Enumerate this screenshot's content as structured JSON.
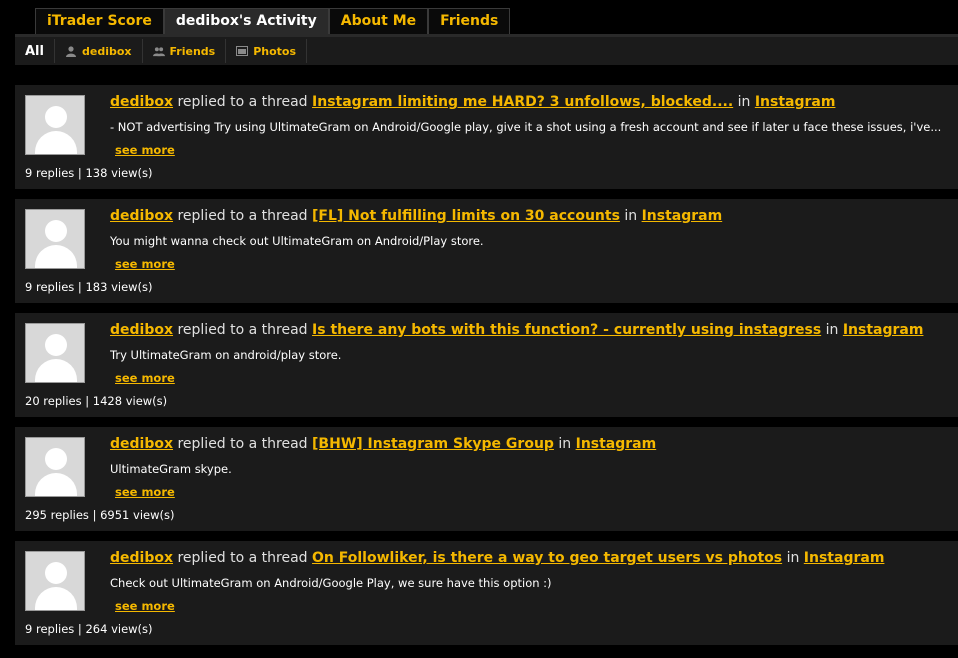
{
  "tabs": [
    {
      "label": "iTrader Score",
      "active": false
    },
    {
      "label": "dedibox's Activity",
      "active": true
    },
    {
      "label": "About Me",
      "active": false
    },
    {
      "label": "Friends",
      "active": false
    }
  ],
  "subtabs": [
    {
      "label": "All",
      "icon": "none",
      "active": true
    },
    {
      "label": "dedibox",
      "icon": "user-icon",
      "active": false
    },
    {
      "label": "Friends",
      "icon": "users-icon",
      "active": false
    },
    {
      "label": "Photos",
      "icon": "photo-icon",
      "active": false
    }
  ],
  "colors": {
    "accent": "#f5b800",
    "panel": "#1b1b1b",
    "background": "#000000"
  },
  "items": [
    {
      "user": "dedibox",
      "action": " replied to a thread ",
      "thread": "Instagram limiting me HARD? 3 unfollows, blocked....",
      "in": " in ",
      "forum": "Instagram",
      "snippet": "- NOT advertising Try using UltimateGram on Android/Google play, give it a shot using a fresh account and see if later u face these issues, i've...",
      "see_more": "see more",
      "stats": "9 replies | 138 view(s)"
    },
    {
      "user": "dedibox",
      "action": " replied to a thread ",
      "thread": "[FL] Not fulfilling limits on 30 accounts",
      "in": " in ",
      "forum": "Instagram",
      "snippet": "You might wanna check out UltimateGram on Android/Play store.",
      "see_more": "see more",
      "stats": "9 replies | 183 view(s)"
    },
    {
      "user": "dedibox",
      "action": " replied to a thread ",
      "thread": "Is there any bots with this function? - currently using instagress",
      "in": " in ",
      "forum": "Instagram",
      "snippet": "Try UltimateGram on android/play store.",
      "see_more": "see more",
      "stats": "20 replies | 1428 view(s)"
    },
    {
      "user": "dedibox",
      "action": " replied to a thread ",
      "thread": "[BHW] Instagram Skype Group",
      "in": " in ",
      "forum": "Instagram",
      "snippet": "UltimateGram skype.",
      "see_more": "see more",
      "stats": "295 replies | 6951 view(s)"
    },
    {
      "user": "dedibox",
      "action": " replied to a thread ",
      "thread": "On Followliker, is there a way to geo target users vs photos",
      "in": " in ",
      "forum": "Instagram",
      "snippet": "Check out UltimateGram on Android/Google Play, we sure have this option :)",
      "see_more": "see more",
      "stats": "9 replies | 264 view(s)"
    }
  ]
}
